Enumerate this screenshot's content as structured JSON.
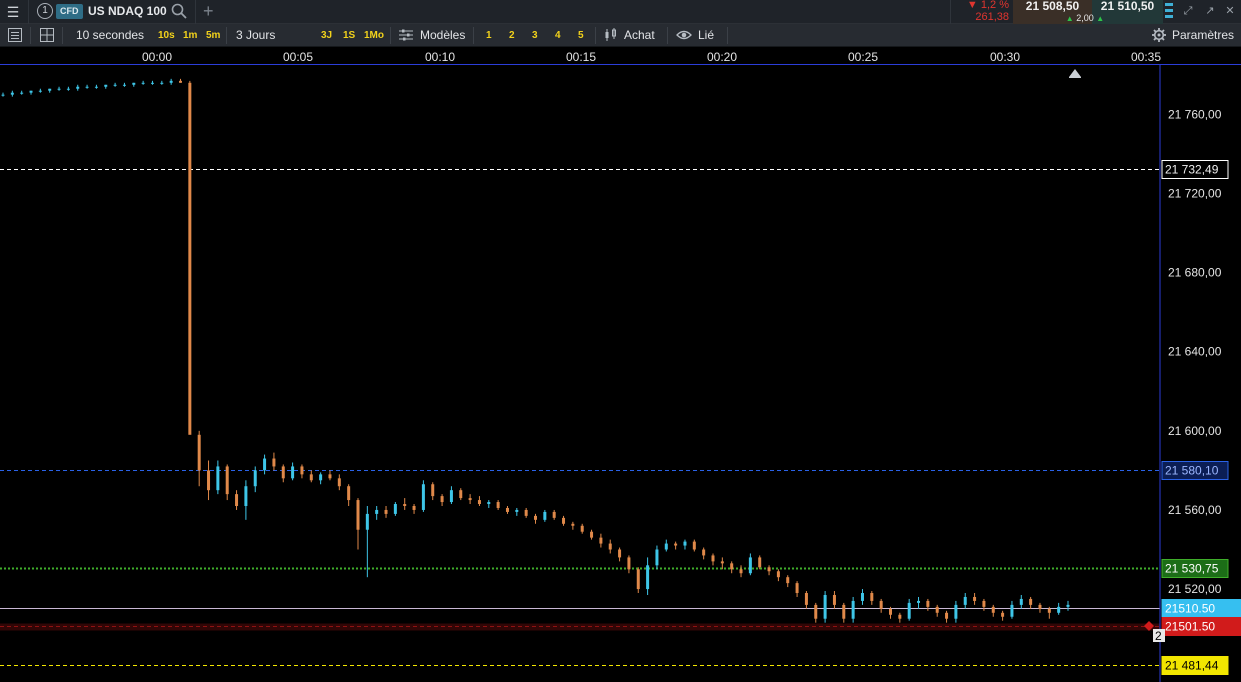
{
  "header": {
    "menu_icon": "hamburger-icon",
    "instrument_number": "1",
    "badge": "CFD",
    "instrument": "US NDAQ 100",
    "search_icon": "search-icon",
    "add_icon": "plus-icon",
    "change_pct": "▼ 1,2 %",
    "change_abs": "261,38",
    "sell_price": "21 508,50",
    "buy_price": "21 510,50",
    "spread": "2,00",
    "colors": {
      "down": "#e0352f",
      "up": "#2ec44a",
      "sell_bg": "#3a2f27",
      "buy_bg": "#223838"
    }
  },
  "toolbar": {
    "interval": "10 secondes",
    "quick_intervals": [
      "10s",
      "1m",
      "5m"
    ],
    "period": "3 Jours",
    "quick_periods": [
      "3J",
      "1S",
      "1Mo"
    ],
    "templates": "Modèles",
    "template_slots": [
      "1",
      "2",
      "3",
      "4",
      "5"
    ],
    "order": "Achat",
    "link": "Lié",
    "settings": "Paramètres"
  },
  "time_axis": [
    "00:00",
    "00:05",
    "00:10",
    "00:15",
    "00:20",
    "00:25",
    "00:30",
    "00:35"
  ],
  "chart_data": {
    "type": "candlestick",
    "x_labels": [
      "00:00",
      "00:05",
      "00:10",
      "00:15",
      "00:20",
      "00:25",
      "00:30",
      "00:35"
    ],
    "y_ticks": [
      "21 760,00",
      "21 720,00",
      "21 680,00",
      "21 640,00",
      "21 600,00",
      "21 560,00",
      "21 520,00"
    ],
    "y_tick_values": [
      21760,
      21720,
      21680,
      21640,
      21600,
      21560,
      21520
    ],
    "ylim": [
      21473,
      21785
    ],
    "colors": {
      "up": "#3ec6e8",
      "down": "#e0894a",
      "axis": "#2b3dd9"
    },
    "horizontal_lines": [
      {
        "label": "21 732,49",
        "value": 21732.49,
        "color": "#ffffff",
        "style": "dashed"
      },
      {
        "label": "21 580,10",
        "value": 21580.1,
        "color": "#2a62e8",
        "style": "dashed"
      },
      {
        "label": "21 530,75",
        "value": 21530.75,
        "color": "#3fae2a",
        "style": "dotted"
      },
      {
        "label": "21510.50",
        "value": 21510.5,
        "color": "#c9b8d4",
        "style": "solid"
      },
      {
        "label": "21501.50",
        "value": 21501.5,
        "color": "#d11b1b",
        "style": "dashed"
      },
      {
        "label": "21 481,44",
        "value": 21481.44,
        "color": "#f2e600",
        "style": "dashed"
      }
    ],
    "position_marker": "2",
    "candles": [
      [
        21770,
        21771,
        21769,
        21770
      ],
      [
        21770,
        21772,
        21769,
        21771
      ],
      [
        21771,
        21772,
        21770,
        21771
      ],
      [
        21771,
        21772,
        21770,
        21772
      ],
      [
        21772,
        21773,
        21771,
        21772
      ],
      [
        21772,
        21773,
        21771,
        21773
      ],
      [
        21773,
        21774,
        21772,
        21773
      ],
      [
        21773,
        21774,
        21772,
        21773
      ],
      [
        21773,
        21775,
        21772,
        21774
      ],
      [
        21774,
        21775,
        21773,
        21774
      ],
      [
        21774,
        21775,
        21773,
        21774
      ],
      [
        21774,
        21775,
        21773,
        21775
      ],
      [
        21775,
        21776,
        21774,
        21775
      ],
      [
        21775,
        21776,
        21774,
        21775
      ],
      [
        21775,
        21776,
        21774,
        21776
      ],
      [
        21776,
        21777,
        21775,
        21776
      ],
      [
        21776,
        21777,
        21775,
        21776
      ],
      [
        21776,
        21777,
        21775,
        21776
      ],
      [
        21776,
        21778,
        21775,
        21777
      ],
      [
        21777,
        21778,
        21776,
        21776
      ],
      [
        21776,
        21777,
        21600,
        21598
      ],
      [
        21598,
        21600,
        21572,
        21580
      ],
      [
        21580,
        21585,
        21565,
        21570
      ],
      [
        21570,
        21585,
        21568,
        21582
      ],
      [
        21582,
        21583,
        21565,
        21568
      ],
      [
        21568,
        21570,
        21560,
        21562
      ],
      [
        21562,
        21575,
        21555,
        21572
      ],
      [
        21572,
        21582,
        21569,
        21580
      ],
      [
        21580,
        21588,
        21578,
        21586
      ],
      [
        21586,
        21589,
        21580,
        21582
      ],
      [
        21582,
        21583,
        21574,
        21576
      ],
      [
        21576,
        21584,
        21575,
        21582
      ],
      [
        21582,
        21583,
        21576,
        21578
      ],
      [
        21578,
        21580,
        21574,
        21575
      ],
      [
        21575,
        21579,
        21573,
        21578
      ],
      [
        21578,
        21580,
        21575,
        21576
      ],
      [
        21576,
        21578,
        21570,
        21572
      ],
      [
        21572,
        21573,
        21562,
        21565
      ],
      [
        21565,
        21566,
        21540,
        21550
      ],
      [
        21550,
        21562,
        21526,
        21558
      ],
      [
        21558,
        21562,
        21555,
        21560
      ],
      [
        21560,
        21562,
        21556,
        21558
      ],
      [
        21558,
        21564,
        21557,
        21563
      ],
      [
        21563,
        21566,
        21560,
        21562
      ],
      [
        21562,
        21563,
        21558,
        21560
      ],
      [
        21560,
        21575,
        21559,
        21573
      ],
      [
        21573,
        21574,
        21565,
        21567
      ],
      [
        21567,
        21568,
        21562,
        21564
      ],
      [
        21564,
        21572,
        21563,
        21570
      ],
      [
        21570,
        21571,
        21565,
        21566
      ],
      [
        21566,
        21568,
        21563,
        21565
      ],
      [
        21565,
        21567,
        21562,
        21563
      ],
      [
        21563,
        21565,
        21561,
        21564
      ],
      [
        21564,
        21565,
        21560,
        21561
      ],
      [
        21561,
        21562,
        21558,
        21559
      ],
      [
        21559,
        21561,
        21557,
        21560
      ],
      [
        21560,
        21561,
        21556,
        21557
      ],
      [
        21557,
        21558,
        21553,
        21555
      ],
      [
        21555,
        21560,
        21554,
        21559
      ],
      [
        21559,
        21560,
        21555,
        21556
      ],
      [
        21556,
        21557,
        21552,
        21553
      ],
      [
        21553,
        21554,
        21550,
        21552
      ],
      [
        21552,
        21553,
        21548,
        21549
      ],
      [
        21549,
        21550,
        21545,
        21546
      ],
      [
        21546,
        21548,
        21541,
        21543
      ],
      [
        21543,
        21545,
        21538,
        21540
      ],
      [
        21540,
        21541,
        21534,
        21536
      ],
      [
        21536,
        21537,
        21528,
        21530
      ],
      [
        21530,
        21531,
        21518,
        21520
      ],
      [
        21520,
        21536,
        21517,
        21532
      ],
      [
        21532,
        21542,
        21530,
        21540
      ],
      [
        21540,
        21545,
        21539,
        21543
      ],
      [
        21543,
        21544,
        21540,
        21542
      ],
      [
        21542,
        21545,
        21540,
        21544
      ],
      [
        21544,
        21545,
        21539,
        21540
      ],
      [
        21540,
        21541,
        21535,
        21537
      ],
      [
        21537,
        21538,
        21532,
        21534
      ],
      [
        21534,
        21536,
        21530,
        21533
      ],
      [
        21533,
        21534,
        21528,
        21530
      ],
      [
        21530,
        21532,
        21526,
        21528
      ],
      [
        21528,
        21538,
        21527,
        21536
      ],
      [
        21536,
        21537,
        21530,
        21531
      ],
      [
        21531,
        21532,
        21527,
        21529
      ],
      [
        21529,
        21530,
        21524,
        21526
      ],
      [
        21526,
        21527,
        21521,
        21523
      ],
      [
        21523,
        21524,
        21516,
        21518
      ],
      [
        21518,
        21519,
        21510,
        21512
      ],
      [
        21512,
        21513,
        21503,
        21505
      ],
      [
        21505,
        21519,
        21503,
        21517
      ],
      [
        21517,
        21519,
        21510,
        21512
      ],
      [
        21512,
        21513,
        21503,
        21505
      ],
      [
        21505,
        21516,
        21503,
        21514
      ],
      [
        21514,
        21520,
        21512,
        21518
      ],
      [
        21518,
        21519,
        21512,
        21514
      ],
      [
        21514,
        21515,
        21508,
        21510
      ],
      [
        21510,
        21511,
        21505,
        21507
      ],
      [
        21507,
        21508,
        21503,
        21505
      ],
      [
        21505,
        21515,
        21504,
        21513
      ],
      [
        21513,
        21516,
        21510,
        21514
      ],
      [
        21514,
        21515,
        21509,
        21511
      ],
      [
        21511,
        21512,
        21506,
        21508
      ],
      [
        21508,
        21509,
        21503,
        21505
      ],
      [
        21505,
        21514,
        21503,
        21512
      ],
      [
        21512,
        21518,
        21510,
        21516
      ],
      [
        21516,
        21518,
        21512,
        21514
      ],
      [
        21514,
        21515,
        21509,
        21511
      ],
      [
        21511,
        21512,
        21506,
        21508
      ],
      [
        21508,
        21509,
        21504,
        21506
      ],
      [
        21506,
        21514,
        21505,
        21512
      ],
      [
        21512,
        21517,
        21510,
        21515
      ],
      [
        21515,
        21516,
        21510,
        21512
      ],
      [
        21512,
        21513,
        21508,
        21510
      ],
      [
        21510,
        21511,
        21505,
        21508
      ],
      [
        21508,
        21513,
        21507,
        21511
      ],
      [
        21511,
        21514,
        21509,
        21512
      ]
    ]
  }
}
